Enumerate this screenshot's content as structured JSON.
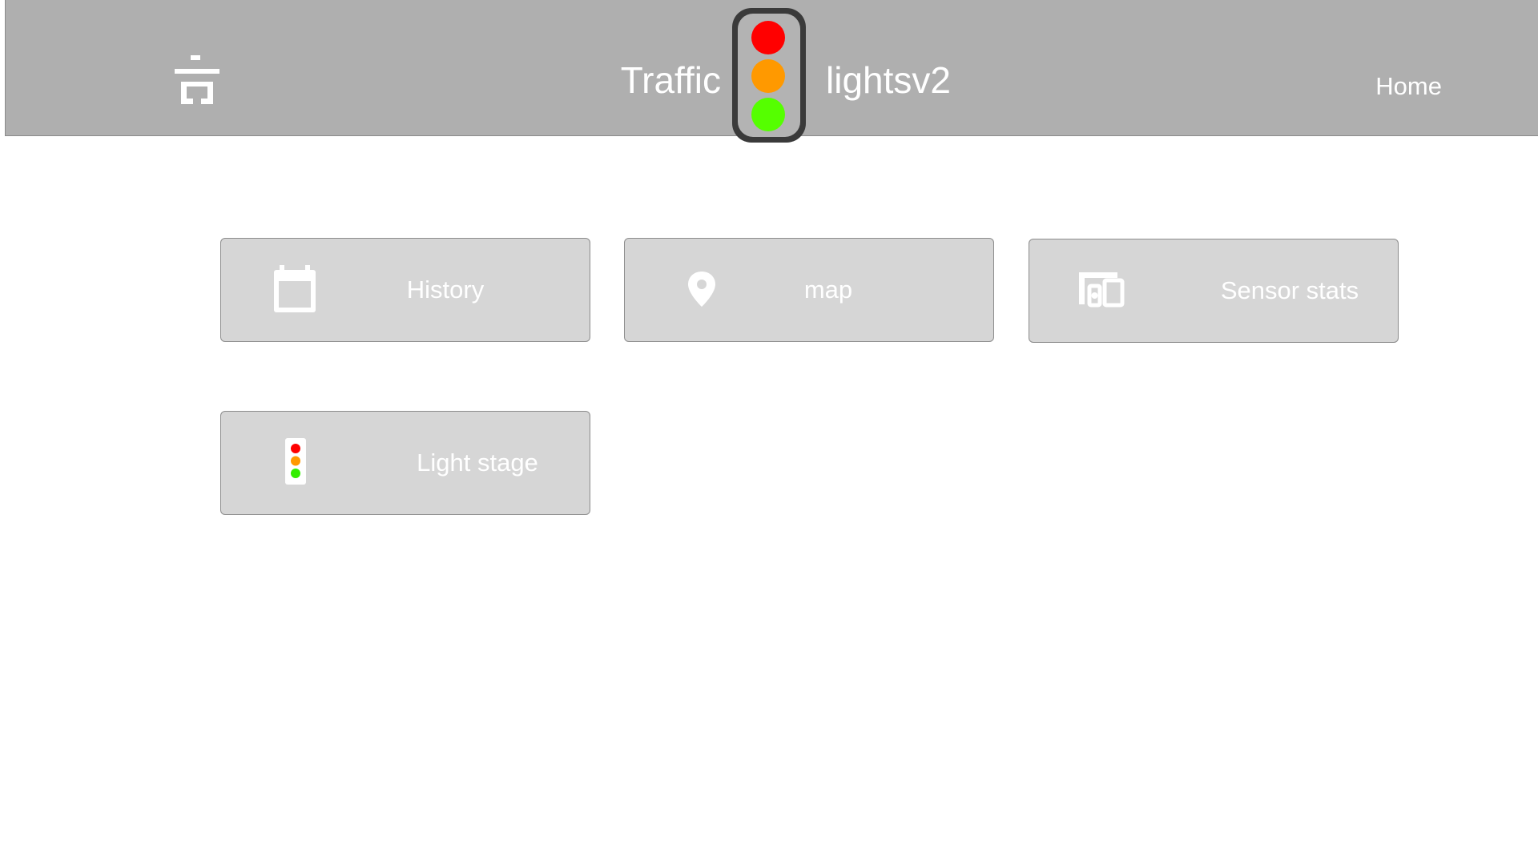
{
  "header": {
    "title_left": "Traffic",
    "title_right": "lightsv2",
    "home_label": "Home",
    "logo_icon": "shrine-icon",
    "traffic_light_colors": {
      "red": "#ff0000",
      "amber": "#ff9900",
      "green": "#55ff00"
    },
    "background": "#afafaf"
  },
  "tiles": [
    {
      "label": "History",
      "icon": "calendar-icon"
    },
    {
      "label": "map",
      "icon": "map-pin-icon"
    },
    {
      "label": "Sensor stats",
      "icon": "devices-icon"
    },
    {
      "label": "Light stage",
      "icon": "traffic-light-icon"
    }
  ],
  "colors": {
    "tile_background": "#d6d6d6",
    "text": "#ffffff",
    "mini_light_red": "#ff0000",
    "mini_light_amber": "#ff9900",
    "mini_light_green": "#33ee00"
  }
}
